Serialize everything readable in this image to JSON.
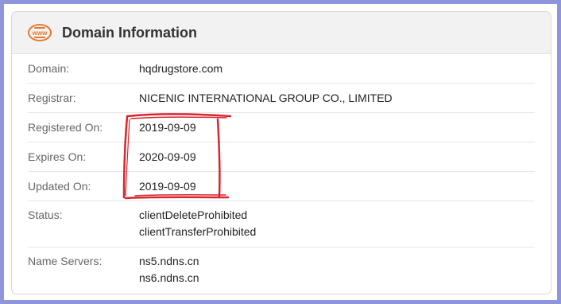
{
  "card": {
    "icon": "www-globe-icon",
    "icon_text": "www",
    "title": "Domain Information",
    "accent_color": "#e8772e"
  },
  "rows": {
    "domain": {
      "label": "Domain:",
      "value": "hqdrugstore.com"
    },
    "registrar": {
      "label": "Registrar:",
      "value": "NICENIC INTERNATIONAL GROUP CO., LIMITED"
    },
    "registered_on": {
      "label": "Registered On:",
      "value": "2019-09-09"
    },
    "expires_on": {
      "label": "Expires On:",
      "value": "2020-09-09"
    },
    "updated_on": {
      "label": "Updated On:",
      "value": "2019-09-09"
    },
    "status": {
      "label": "Status:",
      "values": [
        "clientDeleteProhibited",
        "clientTransferProhibited"
      ]
    },
    "name_servers": {
      "label": "Name Servers:",
      "values": [
        "ns5.ndns.cn",
        "ns6.ndns.cn"
      ]
    }
  },
  "annotation": {
    "type": "hand-drawn red bracket around dates",
    "color": "#d7262e"
  }
}
